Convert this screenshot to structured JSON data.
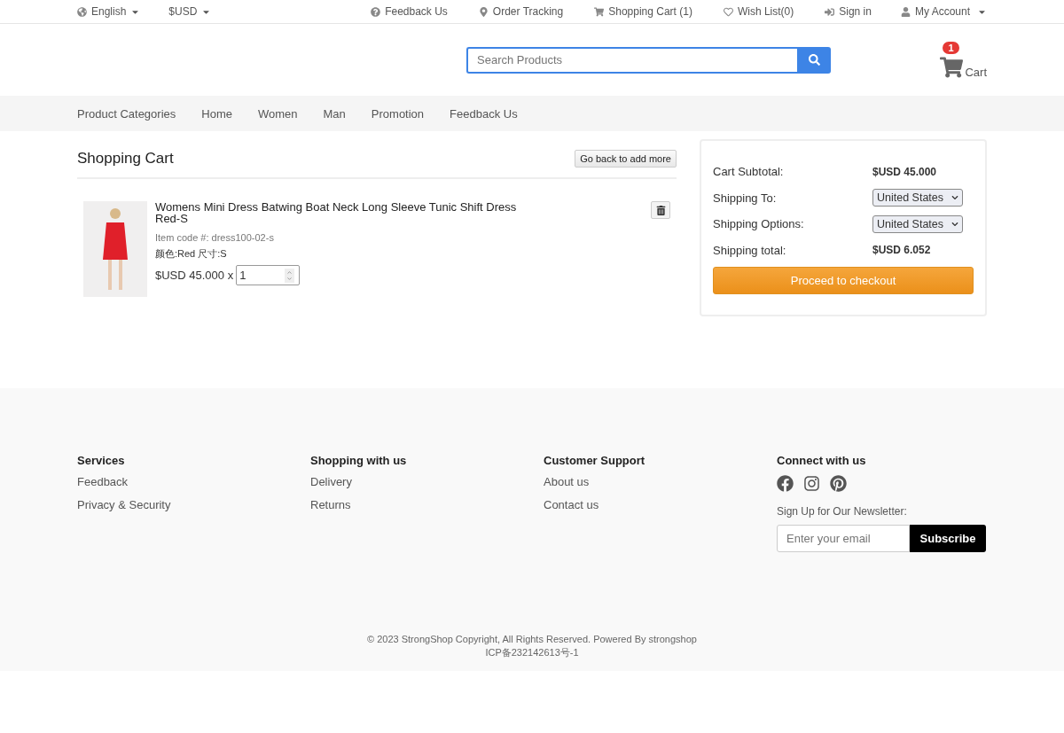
{
  "top_bar": {
    "selectors": [
      {
        "kind": "language",
        "label": "English"
      },
      {
        "kind": "currency",
        "label": "$USD"
      }
    ],
    "links": [
      {
        "kind": "feedback",
        "label": "Feedback Us"
      },
      {
        "kind": "tracking",
        "label": "Order Tracking"
      },
      {
        "kind": "cart",
        "label": "Shopping Cart (1)"
      },
      {
        "kind": "wishlist",
        "label": "Wish List(0)"
      },
      {
        "kind": "signin",
        "label": "Sign in"
      },
      {
        "kind": "account",
        "label": "My Account"
      }
    ]
  },
  "header": {
    "search": {
      "placeholder": "Search Products"
    },
    "cart": {
      "label": "Cart",
      "count": "1"
    }
  },
  "nav": [
    "Product Categories",
    "Home",
    "Women",
    "Man",
    "Promotion",
    "Feedback Us"
  ],
  "cart": {
    "title": "Shopping Cart",
    "back_button": "Go back to add more",
    "items": [
      {
        "name": "Womens Mini Dress Batwing Boat Neck Long Sleeve Tunic Shift Dress Red-S",
        "code": "Item code #: dress100-02-s",
        "options": "颜色:Red 尺寸:S",
        "price": "$USD 45.000 x",
        "quantity": "1"
      }
    ]
  },
  "summary": {
    "rows": [
      {
        "kind": "value",
        "label": "Cart Subtotal:",
        "value": "$USD 45.000"
      },
      {
        "kind": "select",
        "label": "Shipping To:",
        "value": "United States"
      },
      {
        "kind": "select",
        "label": "Shipping Options:",
        "value": "United States"
      },
      {
        "kind": "value",
        "label": "Shipping total:",
        "value": "$USD 6.052"
      }
    ],
    "checkout_button": "Proceed to checkout"
  },
  "footer": {
    "columns": [
      {
        "title": "Services",
        "links": [
          "Feedback",
          "Privacy & Security"
        ]
      },
      {
        "title": "Shopping with us",
        "links": [
          "Delivery",
          "Returns"
        ]
      },
      {
        "title": "Customer Support",
        "links": [
          "About us",
          "Contact us"
        ]
      }
    ],
    "connect": {
      "title": "Connect with us",
      "socials": [
        {
          "kind": "facebook"
        },
        {
          "kind": "instagram"
        },
        {
          "kind": "pinterest"
        }
      ],
      "newsletter_label": "Sign Up for Our Newsletter:",
      "email_placeholder": "Enter your email",
      "subscribe_button": "Subscribe"
    },
    "copyright": "© 2023 StrongShop Copyright, All Rights Reserved. Powered By strongshop",
    "icp": "ICP备232142613号-1"
  }
}
